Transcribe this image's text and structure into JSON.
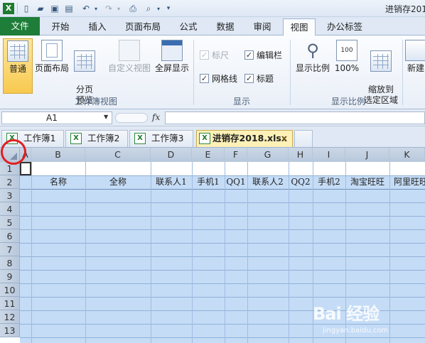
{
  "app": {
    "title": "进销存201"
  },
  "ribbon_tabs": [
    "文件",
    "开始",
    "插入",
    "页面布局",
    "公式",
    "数据",
    "审阅",
    "视图",
    "办公标签"
  ],
  "ribbon": {
    "groups": {
      "workbook_views": {
        "label": "工作簿视图",
        "buttons": [
          "普通",
          "页面布局",
          "分页\n预览",
          "自定义视图",
          "全屏显示"
        ]
      },
      "show": {
        "label": "显示",
        "ruler": "标尺",
        "formula_bar": "编辑栏",
        "gridlines": "网格线",
        "headings": "标题"
      },
      "zoom": {
        "label": "显示比例",
        "zoom_button": "显示比例",
        "hundred_button": "100%",
        "fit_button": "缩放到\n选定区域"
      },
      "window": {
        "new_button": "新建"
      }
    }
  },
  "formula_bar": {
    "name_box": "A1",
    "fx": "fx",
    "content": ""
  },
  "workbook_tabs": [
    {
      "label": "工作簿1"
    },
    {
      "label": "工作簿2"
    },
    {
      "label": "工作簿3"
    },
    {
      "label": "进销存2018.xlsx",
      "close": "×"
    }
  ],
  "sheet": {
    "columns": [
      "A",
      "B",
      "C",
      "D",
      "E",
      "F",
      "G",
      "H",
      "I",
      "J",
      "K"
    ],
    "rows": [
      "1",
      "2",
      "3",
      "4",
      "5",
      "6",
      "7",
      "8",
      "9",
      "10",
      "11",
      "12",
      "13"
    ],
    "header_row": [
      "名称",
      "全称",
      "联系人1",
      "手机1",
      "QQ1",
      "联系人2",
      "QQ2",
      "手机2",
      "淘宝旺旺",
      "阿里旺旺"
    ]
  },
  "watermark": {
    "logo": "Bai 经验",
    "url": "jingyan.baidu.com"
  },
  "colors": {
    "file_tab": "#1e7d38",
    "selection_fill": "#c5dcf6",
    "highlight_circle": "#e02020"
  }
}
